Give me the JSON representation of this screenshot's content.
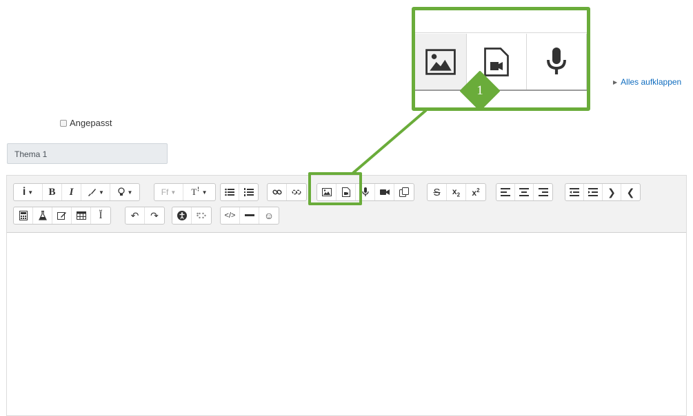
{
  "expand_all": {
    "label": "Alles aufklappen"
  },
  "custom": {
    "label": "Angepasst"
  },
  "section_title": {
    "value": "Thema 1"
  },
  "toolbar": {
    "font_family_label": "Ff",
    "font_size_label": "Tꜝ"
  },
  "badge": {
    "number": "1"
  },
  "colors": {
    "highlight": "#6aac3a",
    "link": "#0f6cbf"
  },
  "icons": [
    "info-icon",
    "bold-icon",
    "italic-icon",
    "font-color-icon",
    "background-color-icon",
    "font-family-icon",
    "font-size-icon",
    "unordered-list-icon",
    "ordered-list-icon",
    "link-icon",
    "unlink-icon",
    "image-icon",
    "media-icon",
    "record-audio-icon",
    "record-video-icon",
    "manage-files-icon",
    "strikethrough-icon",
    "subscript-icon",
    "superscript-icon",
    "align-left-icon",
    "align-center-icon",
    "align-right-icon",
    "outdent-icon",
    "indent-icon",
    "ltr-icon",
    "rtl-icon",
    "equation-icon",
    "chemistry-icon",
    "wiris-icon",
    "table-icon",
    "special-char-icon",
    "undo-icon",
    "redo-icon",
    "accessibility-checker-icon",
    "screenreader-helper-icon",
    "html-icon",
    "horizontal-rule-icon",
    "emoticon-icon"
  ]
}
